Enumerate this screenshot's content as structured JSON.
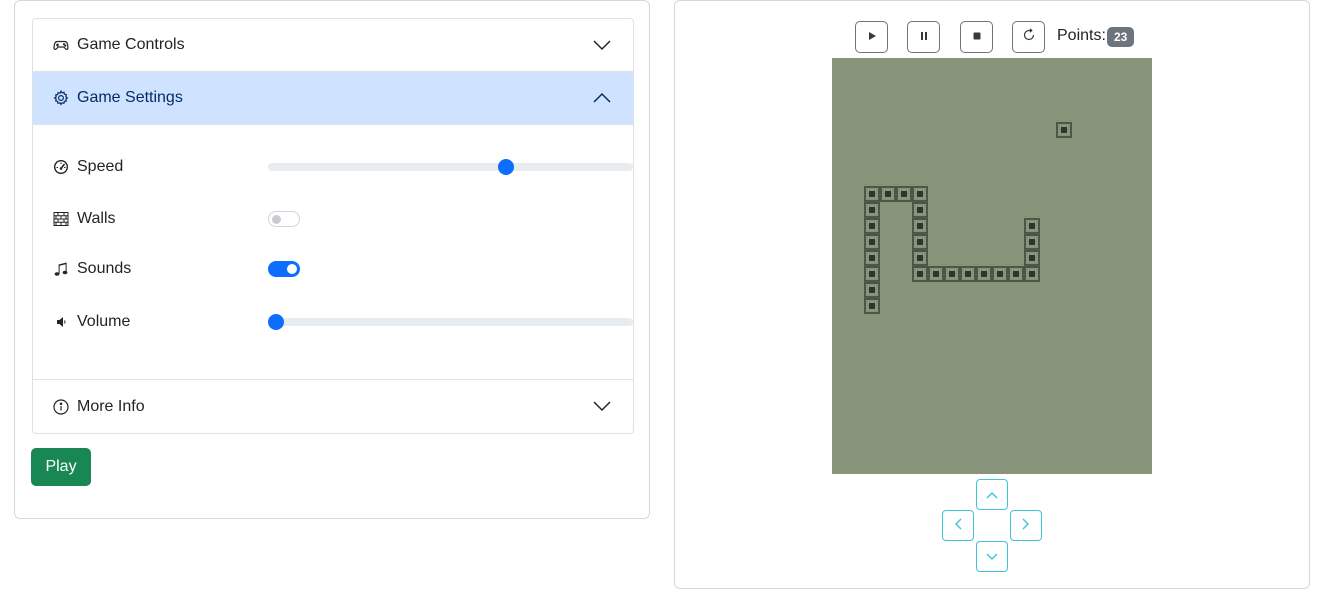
{
  "settings_panel": {
    "sections": {
      "controls": {
        "title": "Game Controls",
        "expanded": false,
        "icon": "gamepad-icon"
      },
      "settings": {
        "title": "Game Settings",
        "expanded": true,
        "icon": "gear-icon"
      },
      "more_info": {
        "title": "More Info",
        "expanded": false,
        "icon": "info-circle-icon"
      }
    },
    "speed": {
      "label": "Speed",
      "value_fraction": 0.66,
      "icon": "speedometer-icon"
    },
    "walls": {
      "label": "Walls",
      "enabled": false,
      "icon": "bricks-icon"
    },
    "sounds": {
      "label": "Sounds",
      "enabled": true,
      "icon": "music-note-icon"
    },
    "volume": {
      "label": "Volume",
      "value_fraction": 0.0,
      "icon": "volume-icon"
    },
    "play_button": "Play"
  },
  "game": {
    "toolbar": {
      "play_icon": "play-icon",
      "pause_icon": "pause-icon",
      "stop_icon": "stop-icon",
      "restart_icon": "restart-icon"
    },
    "points_label": "Points:",
    "points": "23",
    "grid": {
      "cols": 20,
      "rows": 26
    },
    "food": [
      14,
      4
    ],
    "snake": [
      [
        2,
        8
      ],
      [
        2,
        9
      ],
      [
        2,
        10
      ],
      [
        2,
        11
      ],
      [
        2,
        12
      ],
      [
        2,
        13
      ],
      [
        2,
        14
      ],
      [
        2,
        15
      ],
      [
        3,
        8
      ],
      [
        4,
        8
      ],
      [
        5,
        8
      ],
      [
        5,
        9
      ],
      [
        5,
        10
      ],
      [
        5,
        11
      ],
      [
        5,
        12
      ],
      [
        5,
        13
      ],
      [
        6,
        13
      ],
      [
        7,
        13
      ],
      [
        8,
        13
      ],
      [
        9,
        13
      ],
      [
        10,
        13
      ],
      [
        11,
        13
      ],
      [
        12,
        13
      ],
      [
        12,
        12
      ],
      [
        12,
        11
      ],
      [
        12,
        10
      ]
    ],
    "colors": {
      "board": "#879479",
      "cell_border": "#4d5747",
      "cell_fill": "#2f3530"
    },
    "dpad": {
      "up": "chevron-up-icon",
      "down": "chevron-down-icon",
      "left": "chevron-left-icon",
      "right": "chevron-right-icon"
    }
  }
}
